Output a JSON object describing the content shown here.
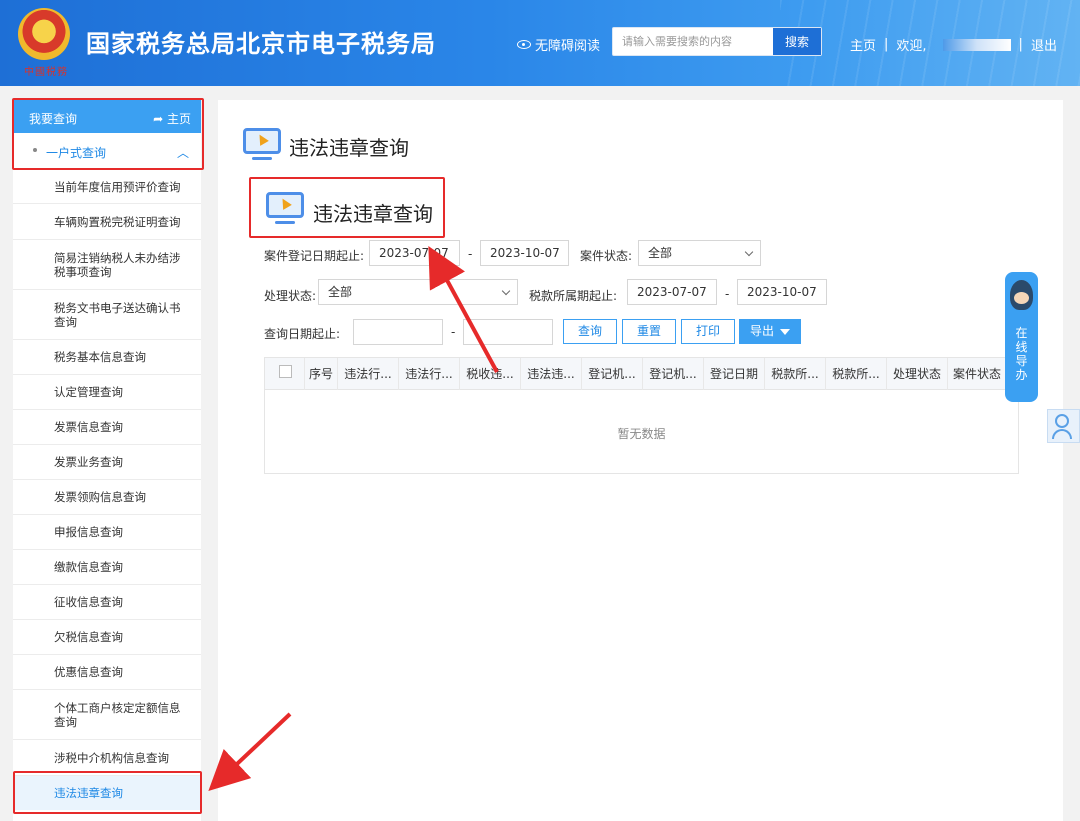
{
  "header": {
    "emblem_caption": "中國税務",
    "site_title": "国家税务总局北京市电子税务局",
    "accessibility_label": "无障碍阅读",
    "search_placeholder": "请输入需要搜索的内容",
    "search_button": "搜索",
    "home_link": "主页",
    "welcome": "欢迎,",
    "logout": "退出"
  },
  "sidebar": {
    "top_label": "我要查询",
    "home_label": "主页",
    "home_icon": "back-arrow-icon",
    "section_label": "一户式查询",
    "items": [
      "当前年度信用预评价查询",
      "车辆购置税完税证明查询",
      "简易注销纳税人未办结涉税事项查询",
      "税务文书电子送达确认书查询",
      "税务基本信息查询",
      "认定管理查询",
      "发票信息查询",
      "发票业务查询",
      "发票领购信息查询",
      "申报信息查询",
      "缴款信息查询",
      "征收信息查询",
      "欠税信息查询",
      "优惠信息查询",
      "个体工商户核定定额信息查询",
      "涉税中介机构信息查询",
      "违法违章查询"
    ]
  },
  "main": {
    "page_title": "违法违章查询",
    "zoom_title": "违法违章查询",
    "form": {
      "reg_date_label": "案件登记日期起止:",
      "reg_date_from": "2023-07-07",
      "reg_date_to": "2023-10-07",
      "case_status_label": "案件状态:",
      "case_status_value": "全部",
      "handle_status_label": "处理状态:",
      "handle_status_value": "全部",
      "tax_period_label": "税款所属期起止:",
      "tax_period_from": "2023-07-07",
      "tax_period_to": "2023-10-07",
      "query_date_label": "查询日期起止:",
      "query_date_from": "",
      "query_date_to": "",
      "dash": "-"
    },
    "buttons": {
      "query": "查询",
      "reset": "重置",
      "print": "打印",
      "export": "导出"
    },
    "table": {
      "columns": [
        "序号",
        "违法行...",
        "违法行...",
        "税收违...",
        "违法违...",
        "登记机...",
        "登记机...",
        "登记日期",
        "税款所...",
        "税款所...",
        "处理状态",
        "案件状态"
      ],
      "empty_text": "暂无数据"
    }
  },
  "floating": {
    "guide_text": [
      "在",
      "线",
      "导",
      "办"
    ]
  },
  "colors": {
    "header_blue": "#2a86e8",
    "accent": "#3ba0f2",
    "callout_red": "#e62a2a"
  }
}
